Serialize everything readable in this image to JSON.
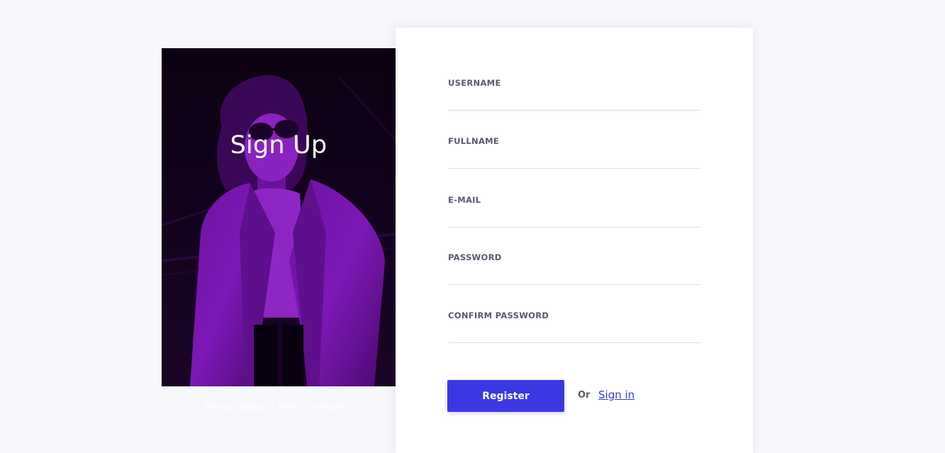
{
  "hero": {
    "title": "Sign Up",
    "image_name": "woman-in-coat-purple-duotone-photo",
    "policy_link": "Privacy policy & Term of service"
  },
  "form": {
    "fields": [
      {
        "label": "USERNAME",
        "value": ""
      },
      {
        "label": "FULLNAME",
        "value": ""
      },
      {
        "label": "E-MAIL",
        "value": ""
      },
      {
        "label": "PASSWORD",
        "value": ""
      },
      {
        "label": "CONFIRM PASSWORD",
        "value": ""
      }
    ],
    "register_label": "Register",
    "or_label": "Or",
    "signin_label": "Sign in"
  },
  "colors": {
    "page_bg": "#f7f8fc",
    "accent": "#3b38e3",
    "image_tint": "#7d14b8"
  }
}
